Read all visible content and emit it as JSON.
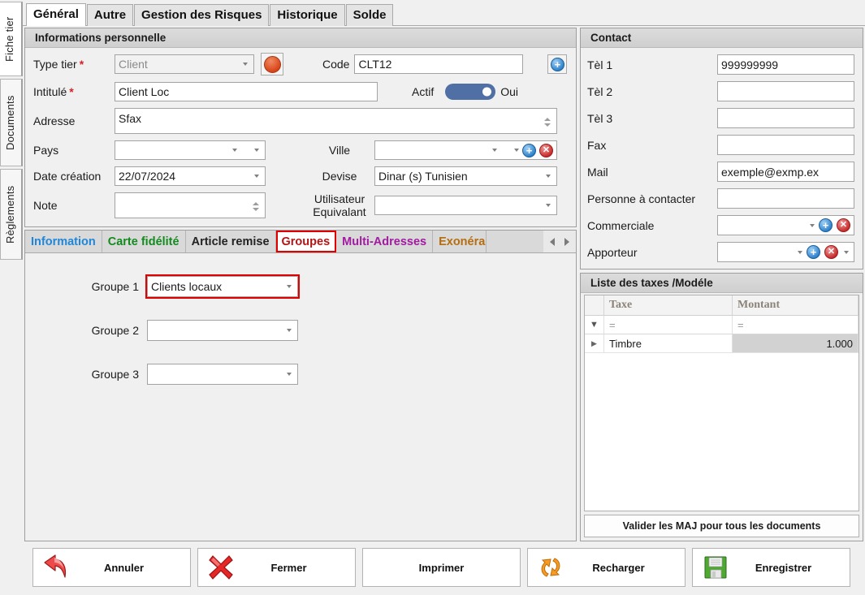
{
  "window": {
    "vertical_tabs": [
      {
        "label": "Fiche tier",
        "selected": true
      },
      {
        "label": "Documents",
        "selected": false
      },
      {
        "label": "Règlements",
        "selected": false
      }
    ],
    "tabs": [
      {
        "label": "Général",
        "selected": true
      },
      {
        "label": "Autre",
        "selected": false
      },
      {
        "label": "Gestion des Risques",
        "selected": false
      },
      {
        "label": "Historique",
        "selected": false
      },
      {
        "label": "Solde",
        "selected": false
      }
    ]
  },
  "personal": {
    "title": "Informations personnelle",
    "type_tier_label": "Type tier",
    "type_tier_value": "Client",
    "type_tier_required": "*",
    "color_button": "color-dot-button",
    "color_dot": "#d8431a",
    "code_label": "Code",
    "code_value": "CLT12",
    "add_button_icon": "add-circle-icon",
    "intitule_label": "Intitulé",
    "intitule_required": "*",
    "intitule_value": "Client Loc",
    "actif_label": "Actif",
    "actif_state": "Oui",
    "adresse_label": "Adresse",
    "adresse_value": "Sfax",
    "pays_label": "Pays",
    "pays_value": "",
    "ville_label": "Ville",
    "ville_value": "",
    "date_creation_label": "Date création",
    "date_creation_value": "22/07/2024",
    "devise_label": "Devise",
    "devise_value": "Dinar (s) Tunisien",
    "note_label": "Note",
    "note_value": "",
    "utilisateur_label_line1": "Utilisateur",
    "utilisateur_label_line2": "Equivalant",
    "utilisateur_value": ""
  },
  "subtabs": {
    "items": [
      {
        "label": "Information",
        "color": "#1f86d8",
        "selected": false
      },
      {
        "label": "Carte fidélité",
        "color": "#138a1e",
        "selected": false
      },
      {
        "label": "Article remise",
        "color": "#222222",
        "selected": false
      },
      {
        "label": "Groupes",
        "color": "#b31515",
        "selected": true
      },
      {
        "label": "Multi-Adresses",
        "color": "#a01ba0",
        "selected": false
      },
      {
        "label": "Exonéra",
        "color": "#b56d10",
        "selected": false
      }
    ],
    "nav_prev": "prev-arrow-icon",
    "nav_next": "next-arrow-icon"
  },
  "groupes": {
    "rows": [
      {
        "label": "Groupe 1",
        "value": "Clients locaux",
        "highlighted": true
      },
      {
        "label": "Groupe 2",
        "value": "",
        "highlighted": false
      },
      {
        "label": "Groupe 3",
        "value": "",
        "highlighted": false
      }
    ]
  },
  "contact": {
    "title": "Contact",
    "fields": [
      {
        "label": "Tèl 1",
        "value": "999999999",
        "type": "text"
      },
      {
        "label": "Tèl 2",
        "value": "",
        "type": "text"
      },
      {
        "label": "Tèl 3",
        "value": "",
        "type": "text"
      },
      {
        "label": "Fax",
        "value": "",
        "type": "text"
      },
      {
        "label": "Mail",
        "value": "exemple@exmp.ex",
        "type": "text"
      },
      {
        "label": "Personne à contacter",
        "value": "",
        "type": "text"
      },
      {
        "label": "Commerciale",
        "value": "",
        "type": "lookup"
      },
      {
        "label": "Apporteur",
        "value": "",
        "type": "lookup2"
      }
    ]
  },
  "taxes": {
    "title": "Liste des taxes /Modéle",
    "columns": [
      "Taxe",
      "Montant"
    ],
    "filter_row": [
      "=",
      "="
    ],
    "rows": [
      {
        "taxe": "Timbre",
        "montant": "1.000"
      }
    ],
    "validate_button": "Valider les MAJ pour tous les documents"
  },
  "actions": [
    {
      "label": "Annuler",
      "icon": "undo-arrow-icon"
    },
    {
      "label": "Fermer",
      "icon": "close-x-icon"
    },
    {
      "label": "Imprimer",
      "icon": "none"
    },
    {
      "label": "Recharger",
      "icon": "refresh-icon"
    },
    {
      "label": "Enregistrer",
      "icon": "floppy-disk-icon"
    }
  ]
}
